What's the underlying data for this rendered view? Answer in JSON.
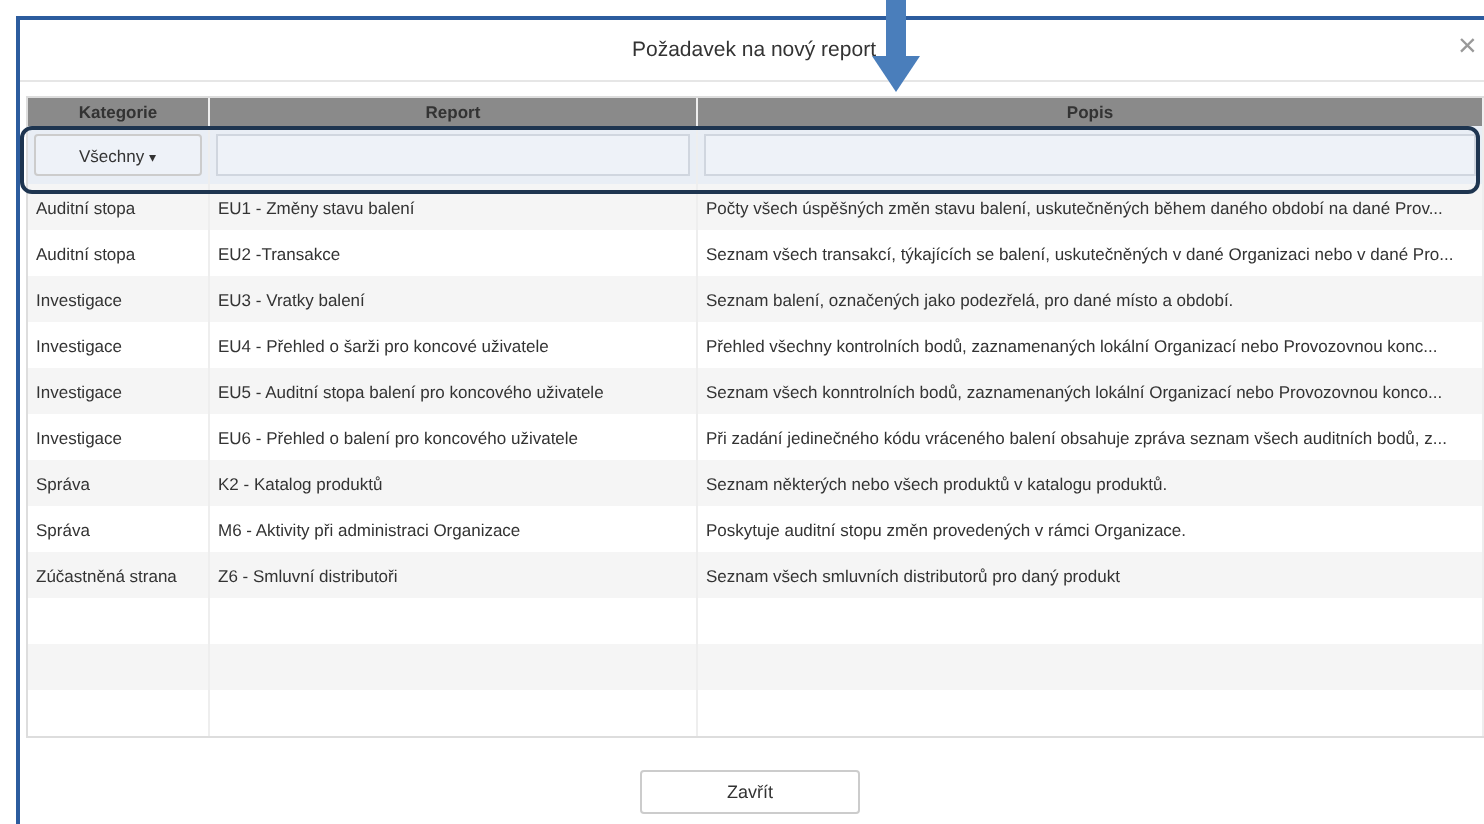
{
  "dialog": {
    "title": "Požadavek na nový report",
    "close": "×"
  },
  "table": {
    "columns": [
      "Kategorie",
      "Report",
      "Popis"
    ],
    "filter": {
      "category": "Všechny",
      "caret": "▾"
    },
    "rows": [
      {
        "category": "Auditní stopa",
        "report": "EU1 - Změny stavu balení",
        "description": "Počty všech úspěšných změn stavu balení, uskutečněných během daného období na dané Prov..."
      },
      {
        "category": "Auditní stopa",
        "report": "EU2 -Transakce",
        "description": "Seznam všech transakcí, týkajících se balení, uskutečněných v dané Organizaci nebo v dané Pro..."
      },
      {
        "category": "Investigace",
        "report": "EU3 - Vratky balení",
        "description": "Seznam balení, označených jako podezřelá, pro dané místo a období."
      },
      {
        "category": "Investigace",
        "report": "EU4 - Přehled o šarži pro koncové uživatele",
        "description": "Přehled všechny kontrolních bodů, zaznamenaných lokální Organizací nebo Provozovnou konc..."
      },
      {
        "category": "Investigace",
        "report": "EU5 - Auditní stopa balení pro koncového uživatele",
        "description": "Seznam všech konntrolních bodů, zaznamenaných lokální Organizací nebo Provozovnou konco..."
      },
      {
        "category": "Investigace",
        "report": "EU6 - Přehled o balení pro koncového uživatele",
        "description": "Při zadání jedinečného kódu vráceného balení obsahuje zpráva seznam všech auditních bodů, z..."
      },
      {
        "category": "Správa",
        "report": "K2 - Katalog produktů",
        "description": "Seznam některých nebo všech produktů v katalogu produktů."
      },
      {
        "category": "Správa",
        "report": "M6 - Aktivity při administraci Organizace",
        "description": "Poskytuje auditní stopu změn provedených v rámci Organizace."
      },
      {
        "category": "Zúčastněná strana",
        "report": "Z6 - Smluvní distributoři",
        "description": "Seznam všech smluvních distributorů pro daný produkt"
      }
    ]
  },
  "buttons": [
    "Zavřít"
  ]
}
